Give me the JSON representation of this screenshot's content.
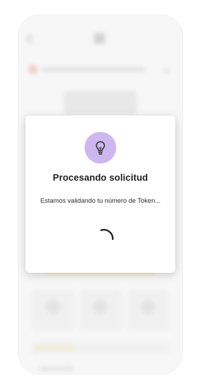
{
  "dialog": {
    "title": "Procesando solicitud",
    "message": "Estamos validando tu número de Token...",
    "icon": "lightbulb-icon",
    "icon_bg_color": "#cdb7ee",
    "status": "loading"
  },
  "background": {
    "blurred": true,
    "top_icon": "app-logo-icon",
    "back_icon": "back-arrow-icon"
  }
}
